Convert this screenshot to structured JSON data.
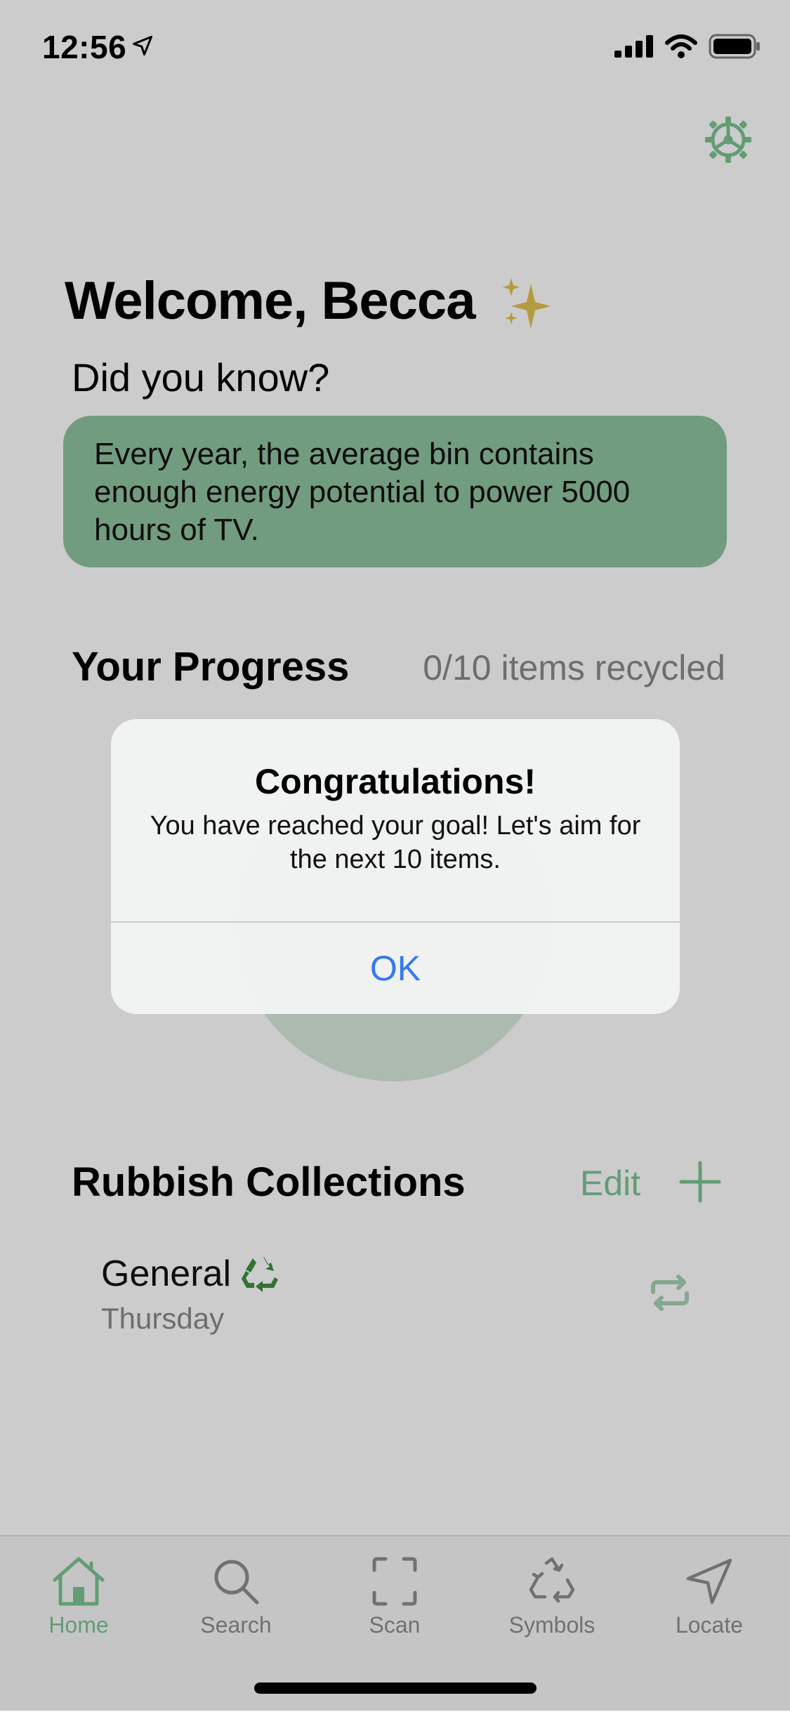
{
  "status_bar": {
    "time": "12:56"
  },
  "header": {
    "welcome": "Welcome, Becca",
    "did_you_know": "Did you know?",
    "fact": "Every year, the average bin contains enough energy potential to power 5000 hours of TV."
  },
  "progress": {
    "title": "Your Progress",
    "count_text": "0/10 items recycled"
  },
  "collections": {
    "title": "Rubbish Collections",
    "edit_label": "Edit",
    "items": [
      {
        "name": "General",
        "day": "Thursday"
      }
    ]
  },
  "alert": {
    "title": "Congratulations!",
    "message": "You have reached your goal! Let's aim for the next 10 items.",
    "ok_label": "OK"
  },
  "tabs": [
    {
      "label": "Home",
      "icon": "home-icon",
      "active": true
    },
    {
      "label": "Search",
      "icon": "search-icon",
      "active": false
    },
    {
      "label": "Scan",
      "icon": "scan-icon",
      "active": false
    },
    {
      "label": "Symbols",
      "icon": "recycle-icon",
      "active": false
    },
    {
      "label": "Locate",
      "icon": "location-arrow-icon",
      "active": false
    }
  ],
  "colors": {
    "accent": "#7cc393",
    "fact_card": "#8fc39f",
    "alert_button": "#3478f6",
    "muted_text": "#8a8a8a"
  }
}
